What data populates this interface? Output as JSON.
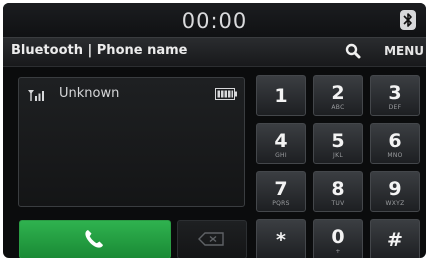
{
  "status_bar": {
    "clock": "00:00",
    "bluetooth_icon": "bluetooth-icon"
  },
  "header": {
    "title": "Bluetooth | Phone name",
    "search_icon": "search-icon",
    "menu_label": "MENU"
  },
  "display": {
    "signal_icon": "signal-strength-icon",
    "contact_name": "Unknown",
    "battery_icon": "battery-icon"
  },
  "actions": {
    "call_icon": "phone-handset-icon",
    "delete_icon": "backspace-icon",
    "call_color": "#1f9a3d"
  },
  "keypad": {
    "keys": [
      {
        "digit": "1",
        "letters": ""
      },
      {
        "digit": "2",
        "letters": "ABC"
      },
      {
        "digit": "3",
        "letters": "DEF"
      },
      {
        "digit": "4",
        "letters": "GHI"
      },
      {
        "digit": "5",
        "letters": "JKL"
      },
      {
        "digit": "6",
        "letters": "MNO"
      },
      {
        "digit": "7",
        "letters": "PQRS"
      },
      {
        "digit": "8",
        "letters": "TUV"
      },
      {
        "digit": "9",
        "letters": "WXYZ"
      },
      {
        "digit": "*",
        "letters": ""
      },
      {
        "digit": "0",
        "letters": "+"
      },
      {
        "digit": "#",
        "letters": ""
      }
    ]
  }
}
